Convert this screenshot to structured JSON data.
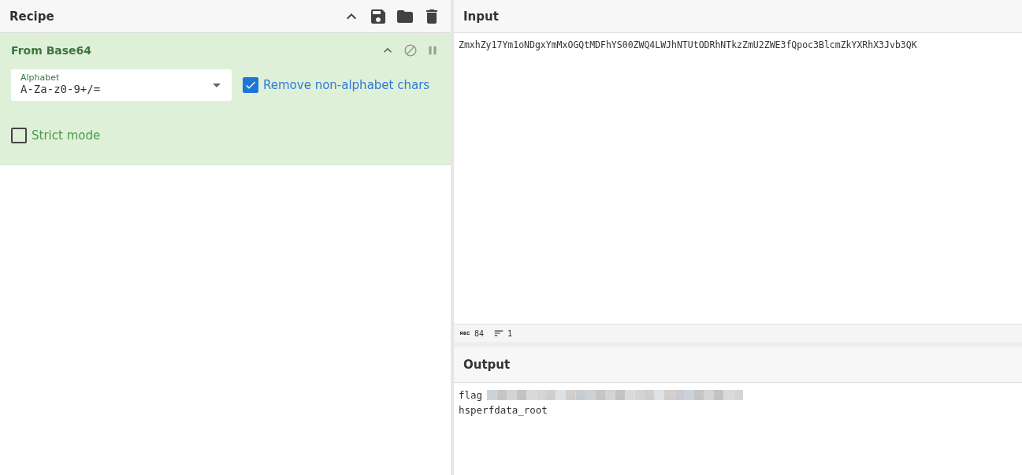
{
  "recipe": {
    "title": "Recipe"
  },
  "operations": [
    {
      "title": "From Base64",
      "alphabet": {
        "label": "Alphabet",
        "value": "A-Za-z0-9+/="
      },
      "options": [
        {
          "label": "Remove non-alphabet chars",
          "checked": true
        },
        {
          "label": "Strict mode",
          "checked": false
        }
      ]
    }
  ],
  "input": {
    "title": "Input",
    "value": "ZmxhZy17Ym1oNDgxYmMxOGQtMDFhYS00ZWQ4LWJhNTUtODRhNTkzZmU2ZWE3fQpoc3BlcmZkYXRhX3Jvb3QK"
  },
  "status_bar": {
    "length": "84",
    "lines": "1"
  },
  "output": {
    "title": "Output",
    "lines": [
      {
        "text": "flag",
        "redacted": true
      },
      {
        "text": "hsperfdata_root",
        "redacted": false
      }
    ]
  }
}
